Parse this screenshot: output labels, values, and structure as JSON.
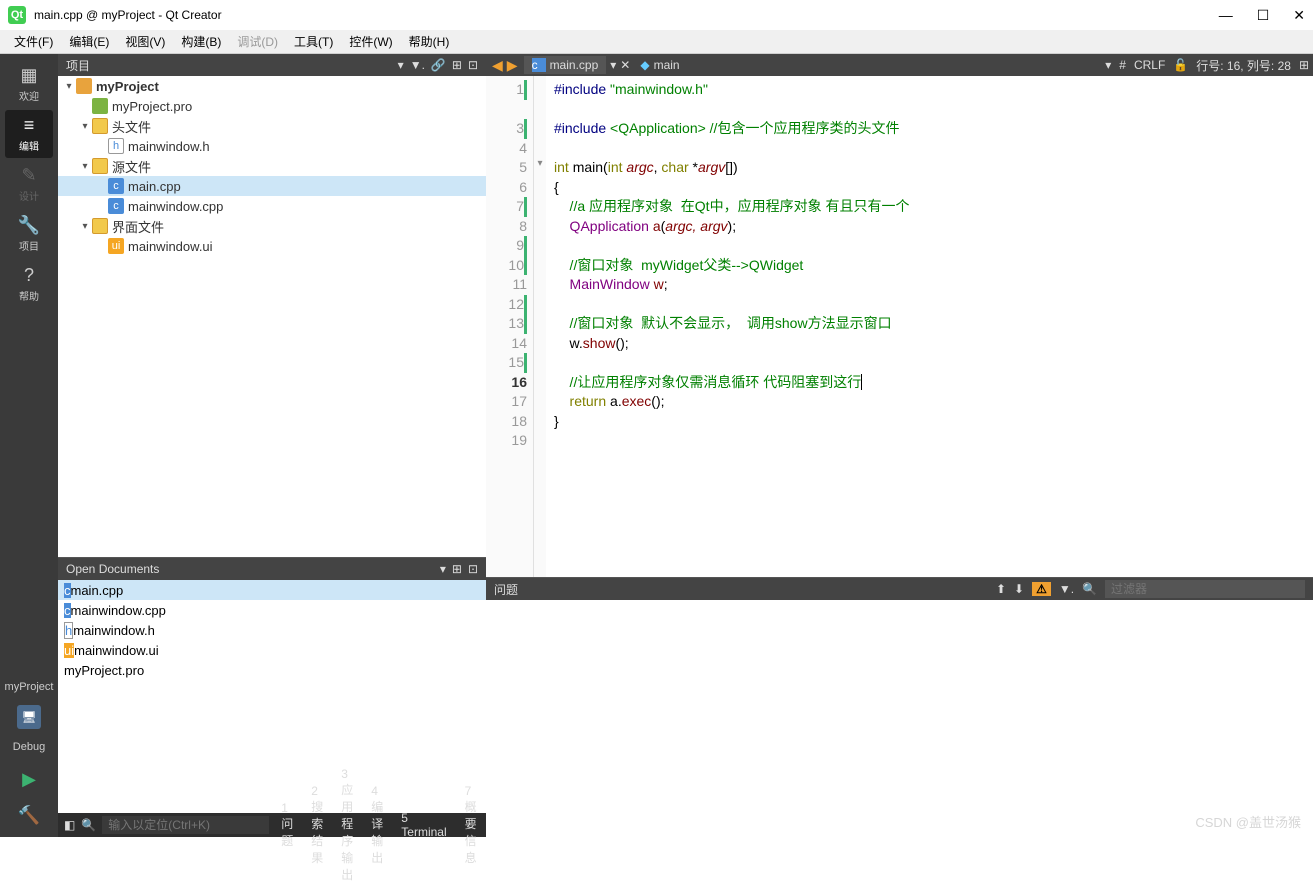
{
  "window": {
    "title": "main.cpp @ myProject - Qt Creator"
  },
  "menu": {
    "file": "文件(F)",
    "edit": "编辑(E)",
    "view": "视图(V)",
    "build": "构建(B)",
    "debug": "调试(D)",
    "tools": "工具(T)",
    "widgets": "控件(W)",
    "help": "帮助(H)"
  },
  "rail": {
    "welcome": "欢迎",
    "edit": "编辑",
    "design": "设计",
    "projects": "项目",
    "help": "帮助",
    "project_name": "myProject",
    "debug": "Debug"
  },
  "panels": {
    "projects": "项目",
    "open_docs": "Open Documents",
    "issues": "问题"
  },
  "tree": {
    "root": "myProject",
    "pro": "myProject.pro",
    "headers_folder": "头文件",
    "header1": "mainwindow.h",
    "sources_folder": "源文件",
    "source1": "main.cpp",
    "source2": "mainwindow.cpp",
    "forms_folder": "界面文件",
    "form1": "mainwindow.ui"
  },
  "open_docs": [
    "main.cpp",
    "mainwindow.cpp",
    "mainwindow.h",
    "mainwindow.ui",
    "myProject.pro"
  ],
  "editor": {
    "filename": "main.cpp",
    "symbol": "main",
    "crlf": "CRLF",
    "pos": "行号: 16, 列号: 28",
    "hash": "#"
  },
  "code": {
    "l1_pp": "#include",
    "l1_str": "\"mainwindow.h\"",
    "l3_pp": "#include",
    "l3_inc": "<QApplication>",
    "l3_cm": "//包含一个应用程序类的头文件",
    "l5_kw1": "int",
    "l5_fn": "main",
    "l5_kw2": "int",
    "l5_arg1": "argc",
    "l5_kw3": "char",
    "l5_arg2": "argv",
    "l6": "{",
    "l7_cm": "    //a 应用程序对象  在Qt中，应用程序对象 有且只有一个",
    "l8_type": "    QApplication",
    "l8_var": "a",
    "l8_args": "argc, argv",
    "l10_cm": "    //窗口对象  myWidget父类-->QWidget",
    "l11_type": "    MainWindow",
    "l11_var": "w",
    "l13_cm": "    //窗口对象  默认不会显示，  调用show方法显示窗口",
    "l14_pre": "    w.",
    "l14_fn": "show",
    "l16_cm": "    //让应用程序对象仅需消息循环 代码阻塞到这行",
    "l17_kw": "    return",
    "l17_var": "a",
    "l17_fn": "exec",
    "l18": "}"
  },
  "filter": {
    "placeholder": "过滤器"
  },
  "locator": {
    "placeholder": "输入以定位(Ctrl+K)"
  },
  "status_tabs": {
    "t1": "1 问题",
    "t2": "2 搜索结果",
    "t3": "3 应用程序输出",
    "t4": "4 编译输出",
    "t5": "5 Terminal",
    "t7": "7 概要信息"
  },
  "watermark": "CSDN @盖世汤猴"
}
